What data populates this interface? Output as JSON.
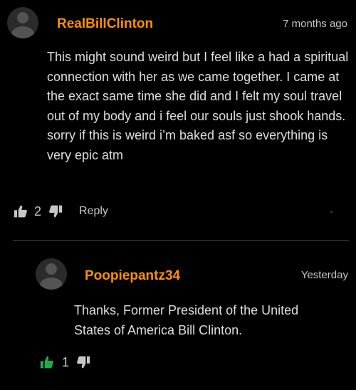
{
  "comment": {
    "username": "RealBillClinton",
    "timestamp": "7 months ago",
    "lines": [
      "This might sound weird but I feel like a had a spiritual connection with her as we came together. I came at the exact same time she did and I felt my soul travel out of my body and i feel our souls just shook hands.",
      "sorry if this is weird i’m baked asf so everything is very epic atm"
    ],
    "like_count": "2",
    "reply_label": "Reply",
    "like_icon": "thumbs-up-icon",
    "dislike_icon": "thumbs-down-icon"
  },
  "reply": {
    "username": "Poopiepantz34",
    "timestamp": "Yesterday",
    "text": "Thanks, Former President of the United States of America Bill Clinton.",
    "like_count": "1",
    "liked": true,
    "like_icon": "thumbs-up-icon",
    "dislike_icon": "thumbs-down-icon"
  },
  "colors": {
    "background": "#000000",
    "username": "#ff9000",
    "text": "#dddddd",
    "muted": "#c7c7c7",
    "liked": "#26a84a"
  }
}
